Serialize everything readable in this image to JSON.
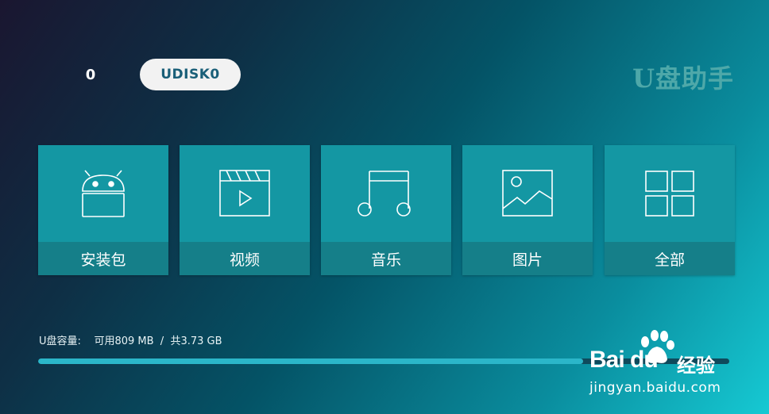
{
  "header": {
    "disk_index": "0",
    "disk_label": "UDISK0",
    "app_title": "U盘助手"
  },
  "tiles": [
    {
      "label": "安装包",
      "icon": "android-icon"
    },
    {
      "label": "视频",
      "icon": "video-clapper-icon"
    },
    {
      "label": "音乐",
      "icon": "music-note-icon"
    },
    {
      "label": "图片",
      "icon": "image-icon"
    },
    {
      "label": "全部",
      "icon": "grid-icon"
    }
  ],
  "storage": {
    "label": "U盘容量:",
    "available": "可用809 MB",
    "separator": "/",
    "total": "共3.73 GB",
    "used_fraction": 0.788
  },
  "watermark": {
    "logo": "Bai du",
    "cn": "经验",
    "url": "jingyan.baidu.com"
  },
  "colors": {
    "tile": "#1497a3",
    "tile_label_bg": "#157f89",
    "progress_fill": "#2bb6c9",
    "title": "#4ea8a9"
  }
}
